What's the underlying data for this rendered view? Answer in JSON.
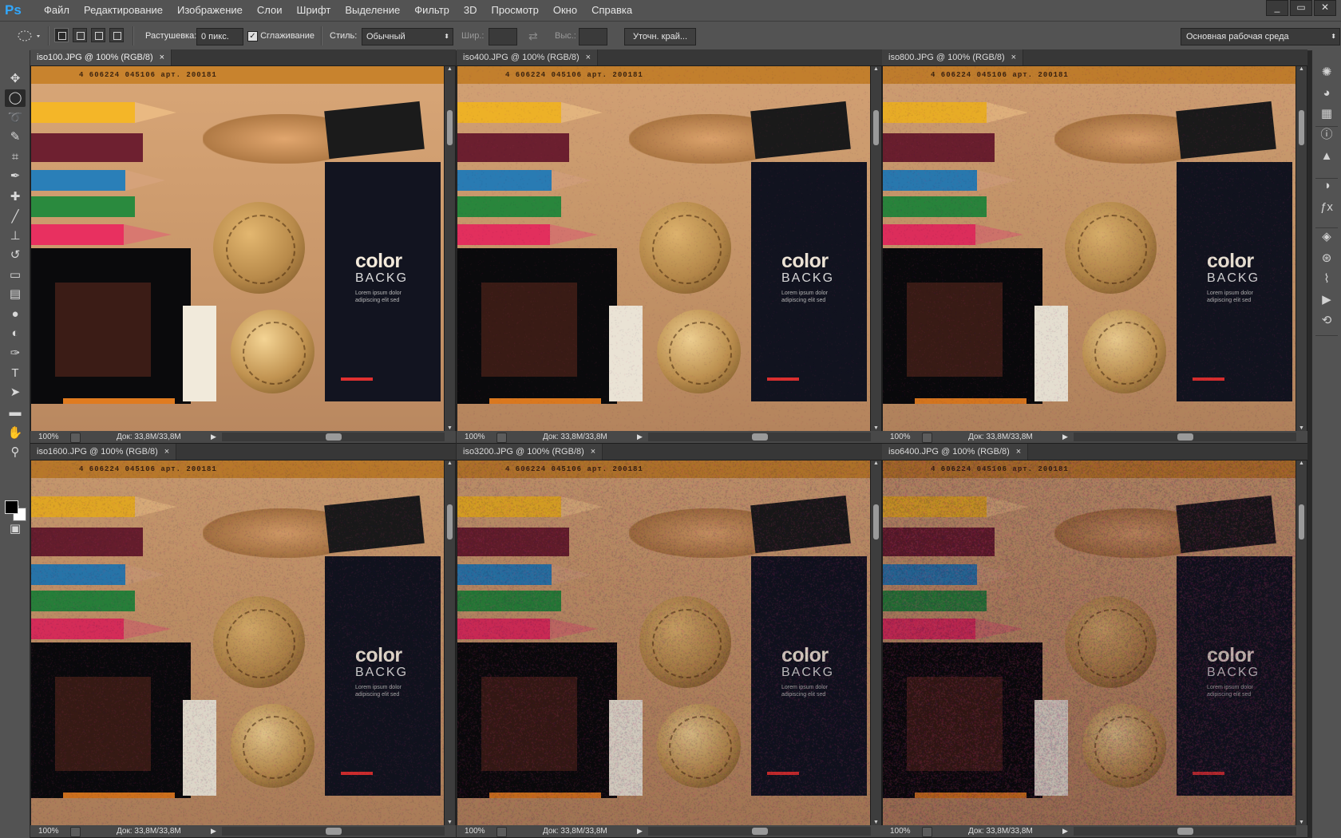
{
  "app": {
    "logo": "Ps",
    "menu": [
      "Файл",
      "Редактирование",
      "Изображение",
      "Слои",
      "Шрифт",
      "Выделение",
      "Фильтр",
      "3D",
      "Просмотр",
      "Окно",
      "Справка"
    ],
    "window_controls": [
      "_",
      "▭",
      "✕"
    ]
  },
  "options": {
    "feather_label": "Растушевка:",
    "feather_value": "0 пикс.",
    "antialias_label": "Сглаживание",
    "antialias_checked": true,
    "style_label": "Стиль:",
    "style_value": "Обычный",
    "width_label": "Шир.:",
    "height_label": "Выс.:",
    "refine_button": "Уточн. край...",
    "workspace_value": "Основная рабочая среда"
  },
  "documents": [
    {
      "title": "iso100.JPG @ 100% (RGB/8)",
      "zoom": "100%",
      "doc_info": "Док: 33,8M/33,8M",
      "noise": 0.0,
      "active": true
    },
    {
      "title": "iso400.JPG @ 100% (RGB/8)",
      "zoom": "100%",
      "doc_info": "Док: 33,8M/33,8M",
      "noise": 0.08,
      "active": false
    },
    {
      "title": "iso800.JPG @ 100% (RGB/8)",
      "zoom": "100%",
      "doc_info": "Док: 33,8M/33,8M",
      "noise": 0.15,
      "active": false
    },
    {
      "title": "iso1600.JPG @ 100% (RGB/8)",
      "zoom": "100%",
      "doc_info": "Док: 33,8M/33,8M",
      "noise": 0.25,
      "active": false
    },
    {
      "title": "iso3200.JPG @ 100% (RGB/8)",
      "zoom": "100%",
      "doc_info": "Док: 33,8M/33,8M",
      "noise": 0.4,
      "active": false
    },
    {
      "title": "iso6400.JPG @ 100% (RGB/8)",
      "zoom": "100%",
      "doc_info": "Док: 33,8M/33,8M",
      "noise": 0.6,
      "active": false
    }
  ],
  "photo": {
    "barcode_text": "4 606224 045106 арт. 200181",
    "box_title": "color",
    "box_subtitle": "BACKG",
    "box_small_text": "Lorem ipsum dolor adipiscing elit sed"
  },
  "colors": {
    "bg_paper": "#d8a677",
    "pencil_yellow": "#f4b628",
    "pencil_maroon": "#6e2030",
    "pencil_blue": "#2a7fb8",
    "pencil_green": "#2a8a3e",
    "pencil_pink": "#e83060",
    "coin": "#b88a4a",
    "box_dark": "#121420"
  },
  "tools": [
    "move-icon",
    "ellipse-marquee-icon",
    "lasso-icon",
    "quick-selection-icon",
    "crop-icon",
    "eyedropper-icon",
    "healing-brush-icon",
    "brush-icon",
    "clone-stamp-icon",
    "history-brush-icon",
    "eraser-icon",
    "gradient-icon",
    "blur-icon",
    "dodge-icon",
    "pen-icon",
    "type-icon",
    "path-selection-icon",
    "rectangle-icon",
    "hand-icon",
    "zoom-icon",
    "quick-mask-icon",
    "screen-mode-icon"
  ],
  "panels": [
    "navigator-icon",
    "color-icon",
    "swatches-icon",
    "info-icon",
    "histogram-icon",
    "adjustments-icon",
    "styles-icon",
    "layers-icon",
    "channels-icon",
    "paths-icon",
    "actions-icon",
    "history-icon"
  ]
}
